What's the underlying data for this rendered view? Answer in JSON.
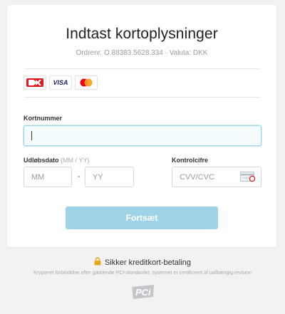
{
  "header": {
    "title": "Indtast kortoplysninger",
    "order": "Ordrenr. O.88383.5628.334 · Valuta: DKK"
  },
  "card_logos": [
    "dankort-icon",
    "visa-icon",
    "mastercard-icon"
  ],
  "visa_text": "VISA",
  "form": {
    "card_number_label": "Kortnummer",
    "card_number_value": "",
    "expiry_label": "Udløbsdato",
    "expiry_hint": "(MM / YY)",
    "month_placeholder": "MM",
    "year_placeholder": "YY",
    "separator": "-",
    "cvc_label": "Kontrolcifre",
    "cvc_placeholder": "CVV/CVC",
    "submit_label": "Fortsæt"
  },
  "footer": {
    "secure_text": "Sikker kreditkort-betaling",
    "note": "Krypteret forbindelse efter gældende PCI-standarder, systemet er certificeret af uafhængig revision",
    "pci_text": "PCi"
  },
  "colors": {
    "button": "#9ed3e8",
    "focus_border": "#9fd6e8",
    "dankort_red": "#e3161b",
    "visa_blue": "#1a1f71",
    "mc_red": "#eb001b",
    "mc_orange": "#f79e1b",
    "lock": "#e6a817"
  }
}
